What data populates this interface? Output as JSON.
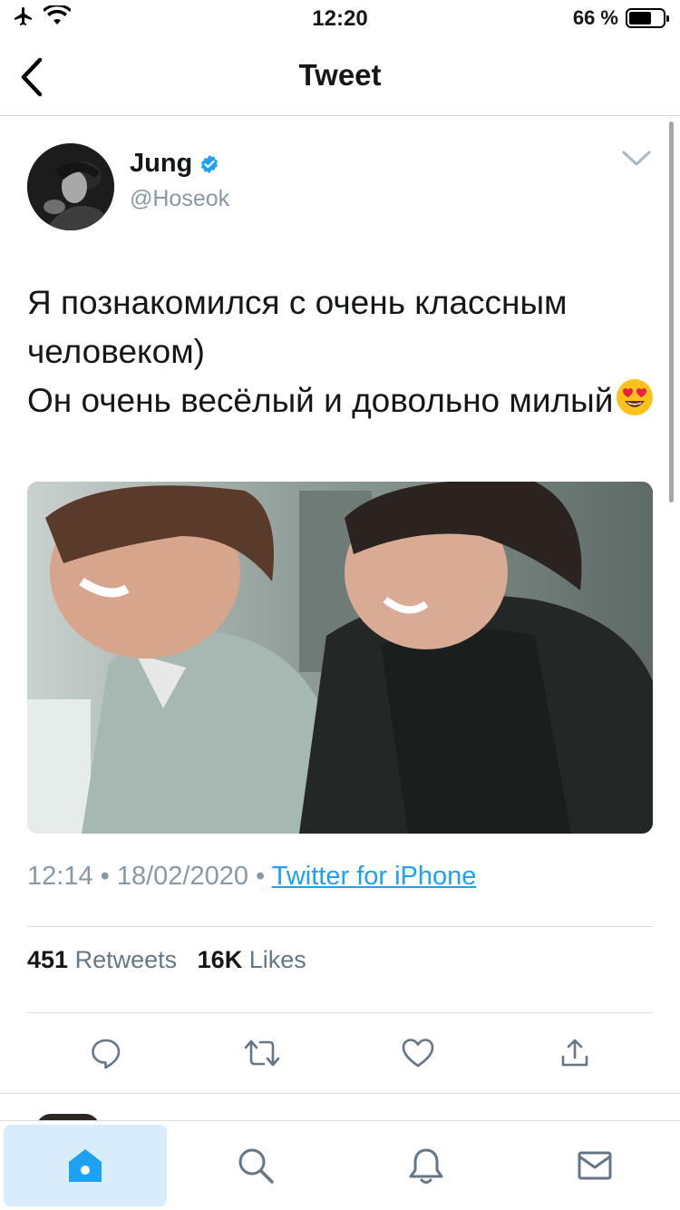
{
  "status_bar": {
    "time": "12:20",
    "battery_text": "66 %",
    "battery_level": 0.66,
    "icons": [
      "airplane-icon",
      "wifi-icon",
      "battery-icon"
    ]
  },
  "nav": {
    "title": "Tweet",
    "back_icon": "chevron-left-icon"
  },
  "tweet": {
    "author": {
      "name": "Jung",
      "handle": "@Hoseok",
      "verified": true
    },
    "text": "Я познакомился с очень классным человеком)\nОн очень весёлый и довольно милый",
    "emoji": "😍",
    "timestamp": "12:14 • 18/02/2020 •",
    "source": "Twitter for iPhone",
    "stats": {
      "retweets_count": "451",
      "retweets_label": "Retweets",
      "likes_count": "16K",
      "likes_label": "Likes"
    },
    "actions": [
      "reply-icon",
      "retweet-icon",
      "like-icon",
      "share-icon"
    ]
  },
  "tabbar": {
    "tabs": [
      "home-icon",
      "search-icon",
      "notifications-icon",
      "messages-icon"
    ],
    "active": "home-icon"
  },
  "colors": {
    "accent": "#1da1f2",
    "secondary_text": "#8899a6",
    "divider": "#d6dde2",
    "active_tab_bg": "#d8ecfb"
  }
}
